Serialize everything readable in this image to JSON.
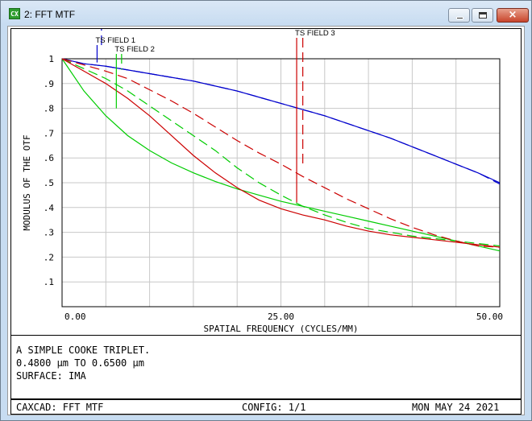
{
  "window": {
    "title": "2: FFT MTF",
    "icon": "app-icon",
    "icon_text": "CX",
    "controls": {
      "minimize": "minimize-icon",
      "maximize": "maximize-icon",
      "close": "×"
    }
  },
  "info": {
    "lines": [
      "A SIMPLE COOKE TRIPLET.",
      "0.4800 µm TO 0.6500 µm",
      "SURFACE: IMA"
    ]
  },
  "footer": {
    "left": "CAXCAD: FFT MTF",
    "center": "CONFIG: 1/1",
    "right": "MON MAY 24 2021"
  },
  "chart_data": {
    "type": "line",
    "title": "",
    "xlabel": "SPATIAL FREQUENCY (CYCLES/MM)",
    "ylabel": "MODULUS OF THE OTF",
    "xlim": [
      0,
      50
    ],
    "ylim": [
      0,
      1
    ],
    "x_ticks": [
      "0.00",
      "25.00",
      "50.00"
    ],
    "y_ticks": [
      ".1",
      ".2",
      ".3",
      ".4",
      ".5",
      ".6",
      ".7",
      ".8",
      ".9",
      "1"
    ],
    "grid": true,
    "x": [
      0,
      2.5,
      5,
      7.5,
      10,
      12.5,
      15,
      17.5,
      20,
      22.5,
      25,
      27.5,
      30,
      32.5,
      35,
      37.5,
      40,
      42.5,
      45,
      47.5,
      50
    ],
    "series": [
      {
        "name": "TS FIELD 1",
        "color": "#0000cc",
        "style": "solid",
        "values": [
          1.0,
          0.98,
          0.97,
          0.955,
          0.94,
          0.925,
          0.91,
          0.89,
          0.87,
          0.845,
          0.82,
          0.795,
          0.77,
          0.74,
          0.71,
          0.68,
          0.645,
          0.61,
          0.575,
          0.54,
          0.5
        ]
      },
      {
        "name": "TS FIELD 1",
        "color": "#0000cc",
        "style": "dashed",
        "values": [
          1.0,
          0.98,
          0.97,
          0.955,
          0.94,
          0.925,
          0.91,
          0.89,
          0.87,
          0.845,
          0.82,
          0.795,
          0.77,
          0.74,
          0.71,
          0.68,
          0.645,
          0.61,
          0.575,
          0.54,
          0.495
        ]
      },
      {
        "name": "TS FIELD 2",
        "color": "#00cc00",
        "style": "solid",
        "values": [
          1.0,
          0.87,
          0.77,
          0.69,
          0.63,
          0.58,
          0.54,
          0.505,
          0.475,
          0.45,
          0.425,
          0.405,
          0.385,
          0.365,
          0.345,
          0.325,
          0.305,
          0.285,
          0.265,
          0.245,
          0.225
        ]
      },
      {
        "name": "TS FIELD 2",
        "color": "#00cc00",
        "style": "dashed",
        "values": [
          1.0,
          0.96,
          0.92,
          0.87,
          0.81,
          0.75,
          0.69,
          0.63,
          0.56,
          0.5,
          0.45,
          0.405,
          0.37,
          0.34,
          0.315,
          0.3,
          0.285,
          0.275,
          0.265,
          0.255,
          0.245
        ]
      },
      {
        "name": "TS FIELD 3",
        "color": "#cc0000",
        "style": "solid",
        "values": [
          1.0,
          0.95,
          0.9,
          0.84,
          0.77,
          0.69,
          0.61,
          0.54,
          0.48,
          0.43,
          0.395,
          0.37,
          0.35,
          0.325,
          0.305,
          0.29,
          0.28,
          0.27,
          0.26,
          0.25,
          0.24
        ]
      },
      {
        "name": "TS FIELD 3",
        "color": "#cc0000",
        "style": "dashed",
        "values": [
          1.0,
          0.975,
          0.95,
          0.92,
          0.875,
          0.83,
          0.78,
          0.725,
          0.67,
          0.62,
          0.575,
          0.525,
          0.48,
          0.435,
          0.395,
          0.355,
          0.32,
          0.29,
          0.265,
          0.245,
          0.24
        ]
      }
    ],
    "field_markers": [
      {
        "label": "TS FIELD 1",
        "color": "#0000cc",
        "x_solid": 4.0,
        "x_dashed": 4.5,
        "y_end": 0.985
      },
      {
        "label": "TS FIELD 2",
        "color": "#00cc00",
        "x_solid": 6.2,
        "x_dashed": 6.8,
        "y_end": 0.8
      },
      {
        "label": "TS FIELD 3",
        "color": "#cc0000",
        "x_solid": 26.8,
        "x_dashed": 27.5,
        "y_end": 0.42
      }
    ]
  }
}
